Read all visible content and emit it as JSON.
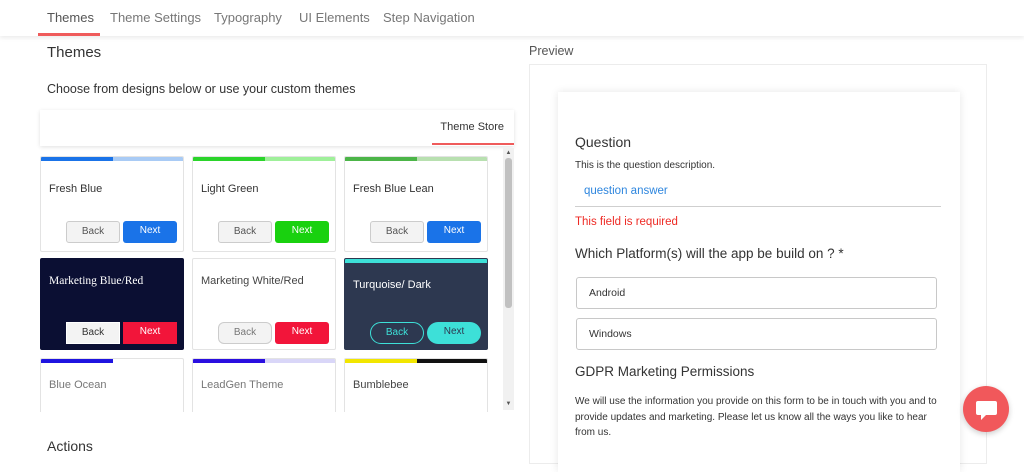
{
  "nav": {
    "tabs": [
      "Themes",
      "Theme Settings",
      "Typography",
      "UI Elements",
      "Step Navigation"
    ],
    "active_tab": "Themes"
  },
  "left": {
    "title": "Themes",
    "subtitle": "Choose from designs below or use your custom themes",
    "store_tab": "Theme Store",
    "actions_heading": "Actions"
  },
  "themes": [
    {
      "name": "Fresh Blue",
      "back": "Back",
      "next": "Next"
    },
    {
      "name": "Light Green",
      "back": "Back",
      "next": "Next"
    },
    {
      "name": "Fresh Blue Lean",
      "back": "Back",
      "next": "Next"
    },
    {
      "name": "Marketing Blue/Red",
      "back": "Back",
      "next": "Next"
    },
    {
      "name": "Marketing White/Red",
      "back": "Back",
      "next": "Next"
    },
    {
      "name": "Turquoise/ Dark",
      "back": "Back",
      "next": "Next"
    },
    {
      "name": "Blue Ocean"
    },
    {
      "name": "LeadGen Theme"
    },
    {
      "name": "Bumblebee"
    }
  ],
  "colors": {
    "accent": "#ef5b5b",
    "fresh_blue": "#1a73e8",
    "light_green": "#19d10f",
    "marketing_dark": "#0b0f33",
    "marketing_red": "#f2153a",
    "turquoise": "#3de0d8",
    "turquoise_dark": "#2d3850",
    "error": "#ee2a24",
    "link": "#2e86de",
    "chat": "#f1585b"
  },
  "preview": {
    "label": "Preview",
    "question_title": "Question",
    "question_description": "This is the question description.",
    "answer": "question answer",
    "error": "This field is required",
    "platform_question": "Which Platform(s) will the app be build on ? *",
    "options": [
      "Android",
      "Windows"
    ],
    "gdpr_title": "GDPR Marketing Permissions",
    "gdpr_text": "We will use the information you provide on this form to be in touch with you and to provide updates and marketing. Please let us know all the ways you like to hear from us."
  },
  "icons": {
    "chat": "chat-bubble-icon",
    "scroll_up": "scroll-up-arrow-icon",
    "scroll_down": "scroll-down-arrow-icon"
  }
}
